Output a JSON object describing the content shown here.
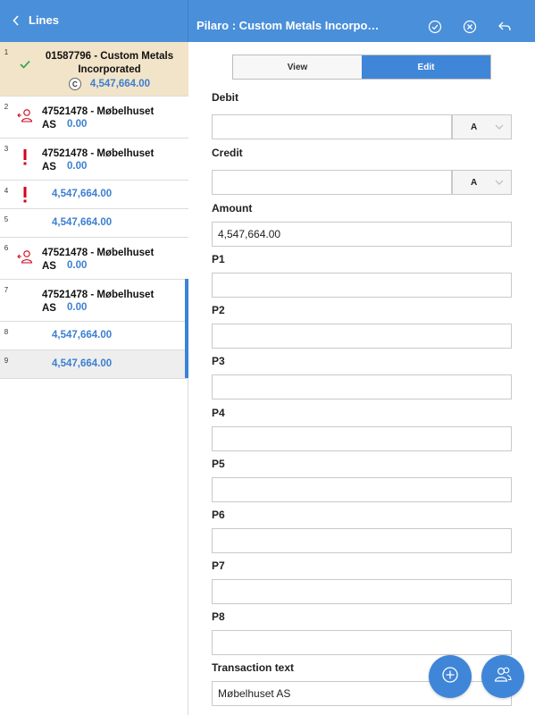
{
  "header": {
    "lines_title": "Lines",
    "title": "Pilaro : Custom Metals Incorpo…",
    "icons": [
      "back-chevron-icon",
      "check-circle-icon",
      "cancel-circle-icon",
      "undo-arrow-icon"
    ]
  },
  "sidebar": {
    "rows": [
      {
        "num": "1",
        "line1": "01587796 - Custom Metals",
        "line2": "Incorporated",
        "badge": "C",
        "amount": "4,547,664.00",
        "icon": "check-icon"
      },
      {
        "num": "2",
        "name": "47521478 - Møbelhuset",
        "name2": "AS",
        "amount": "0.00",
        "icon": "person-arrow-icon"
      },
      {
        "num": "3",
        "name": "47521478 - Møbelhuset",
        "name2": "AS",
        "amount": "0.00",
        "icon": "exclamation-icon"
      },
      {
        "num": "4",
        "amount": "4,547,664.00",
        "icon": "exclamation-icon"
      },
      {
        "num": "5",
        "amount": "4,547,664.00"
      },
      {
        "num": "6",
        "name": "47521478 - Møbelhuset",
        "name2": "AS",
        "amount": "0.00",
        "icon": "person-arrow-icon"
      },
      {
        "num": "7",
        "name": "47521478 - Møbelhuset",
        "name2": "AS",
        "amount": "0.00"
      },
      {
        "num": "8",
        "amount": "4,547,664.00"
      },
      {
        "num": "9",
        "amount": "4,547,664.00"
      }
    ]
  },
  "main": {
    "toggle": {
      "view": "View",
      "edit": "Edit"
    },
    "fields": {
      "debit_label": "Debit",
      "debit_value": "",
      "debit_select": "A",
      "credit_label": "Credit",
      "credit_value": "",
      "credit_select": "A",
      "amount_label": "Amount",
      "amount_value": "4,547,664.00",
      "p1_label": "P1",
      "p2_label": "P2",
      "p3_label": "P3",
      "p4_label": "P4",
      "p5_label": "P5",
      "p6_label": "P6",
      "p7_label": "P7",
      "p8_label": "P8",
      "transaction_label": "Transaction text",
      "transaction_value": "Møbelhuset AS"
    },
    "fabs": [
      "plus-circle-icon",
      "people-icon"
    ]
  },
  "colors": {
    "header": "#4a8fd9",
    "accent": "#3f86d8",
    "selected_row": "#f2e4c8",
    "amount": "#3c7fd0",
    "error": "#d0021b",
    "check": "#3aa655"
  }
}
